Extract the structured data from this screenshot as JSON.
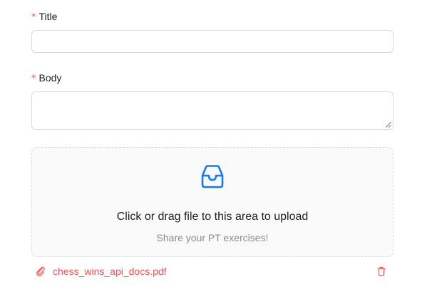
{
  "form": {
    "title_field": {
      "label": "Title",
      "required_mark": "*",
      "value": "",
      "placeholder": ""
    },
    "body_field": {
      "label": "Body",
      "required_mark": "*",
      "value": "",
      "placeholder": ""
    }
  },
  "upload": {
    "icon": "inbox-icon",
    "text": "Click or drag file to this area to upload",
    "hint": "Share your PT exercises!",
    "files": [
      {
        "name": "chess_wins_api_docs.pdf",
        "icon": "paperclip-icon",
        "action_icon": "trash-icon",
        "status": "error"
      }
    ]
  },
  "colors": {
    "accent": "#1677ff",
    "error": "#ff4d4f",
    "border": "#d9d9d9",
    "dragger_bg": "#fafafa"
  }
}
